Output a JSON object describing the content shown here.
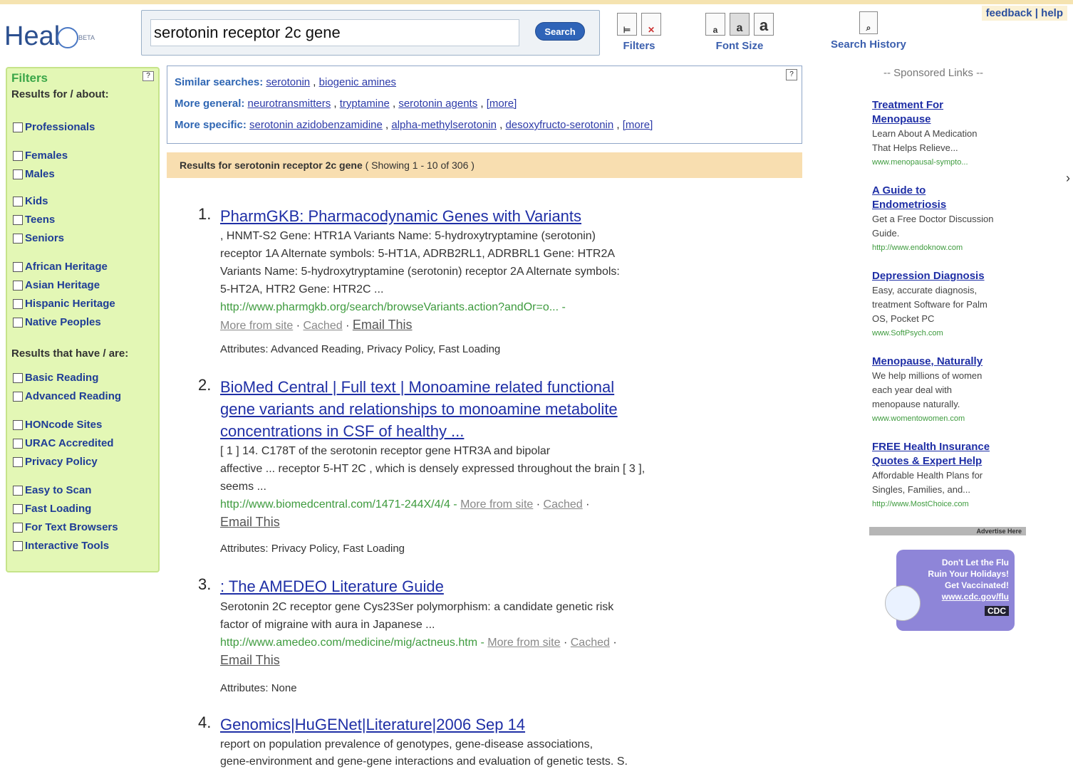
{
  "header": {
    "logo_text": "Heal",
    "logo_beta": "BETA",
    "feedback": "feedback",
    "help": "help",
    "search_value": "serotonin receptor 2c gene",
    "search_button": "Search",
    "filters_label": "Filters",
    "fontsize_label": "Font Size",
    "history_label": "Search History"
  },
  "sidebar": {
    "title": "Filters",
    "help": "?",
    "results_for": "Results for / about:",
    "results_that": "Results that have / are:",
    "items": [
      "Professionals",
      "Females",
      "Males",
      "Kids",
      "Teens",
      "Seniors",
      "African Heritage",
      "Asian Heritage",
      "Hispanic Heritage",
      "Native Peoples",
      "Basic Reading",
      "Advanced Reading",
      "HONcode Sites",
      "URAC Accredited",
      "Privacy Policy",
      "Easy to Scan",
      "Fast Loading",
      "For Text Browsers",
      "Interactive Tools"
    ]
  },
  "similar": {
    "similar_label": "Similar searches:",
    "similar_links": [
      "serotonin",
      "biogenic amines"
    ],
    "general_label": "More general:",
    "general_links": [
      "neurotransmitters",
      "tryptamine",
      "serotonin agents",
      "[more]"
    ],
    "specific_label": "More specific:",
    "specific_links": [
      "serotonin azidobenzamidine",
      "alpha-methylserotonin",
      "desoxyfructo-serotonin",
      "[more]"
    ],
    "help": "?"
  },
  "resbar": {
    "prefix": "Results for",
    "query": "serotonin receptor 2c gene",
    "showing": "( Showing 1 - 10 of 306 )"
  },
  "results": [
    {
      "num": "1.",
      "title": "PharmGKB: Pharmacodynamic Genes with Variants",
      "snippet_lines": [
        ", HNMT-S2 Gene: HTR1A Variants   Name: 5-hydroxytryptamine (serotonin)",
        "receptor 1A Alternate symbols: 5-HT1A, ADRB2RL1, ADRBRL1 Gene: HTR2A",
        "Variants   Name: 5-hydroxytryptamine (serotonin) receptor 2A Alternate symbols:",
        "5-HT2A, HTR2 Gene: HTR2C ..."
      ],
      "url": "http://www.pharmgkb.org/search/browseVariants.action?andOr=o... -",
      "more": "More from site",
      "cached": "Cached",
      "email": "Email This",
      "attributes": "Attributes: Advanced Reading, Privacy Policy, Fast Loading"
    },
    {
      "num": "2.",
      "title_lines": [
        "BioMed Central | Full text | Monoamine related functional",
        "gene variants and relationships to monoamine metabolite",
        "concentrations in CSF of healthy ..."
      ],
      "snippet_lines": [
        "[ 1 ] 14. C178T of the serotonin receptor gene HTR3A and bipolar",
        "affective ... receptor 5-HT 2C , which is densely expressed throughout the brain [ 3 ],",
        "seems ..."
      ],
      "url": "http://www.biomedcentral.com/1471-244X/4/4 -",
      "more": "More from site",
      "cached": "Cached",
      "email": "Email This",
      "attributes": "Attributes: Privacy Policy, Fast Loading"
    },
    {
      "num": "3.",
      "title": ": The AMEDEO Literature Guide",
      "snippet_lines": [
        "Serotonin 2C receptor gene Cys23Ser polymorphism: a candidate genetic risk",
        "factor of migraine with aura in Japanese ..."
      ],
      "url": "http://www.amedeo.com/medicine/mig/actneus.htm -",
      "more": "More from site",
      "cached": "Cached",
      "email": "Email This",
      "attributes": "Attributes: None"
    },
    {
      "num": "4.",
      "title": "Genomics|HuGENet|Literature|2006 Sep 14",
      "snippet_lines": [
        "report on population prevalence of genotypes, gene-disease associations,",
        "gene-environment and gene-gene interactions and evaluation of genetic tests. S."
      ]
    }
  ],
  "ads": {
    "heading": "-- Sponsored Links --",
    "items": [
      {
        "title_lines": [
          "Treatment For",
          "Menopause"
        ],
        "body_lines": [
          "Learn About A Medication",
          "That Helps Relieve..."
        ],
        "url": "www.menopausal-sympto..."
      },
      {
        "title_lines": [
          "A Guide to",
          "Endometriosis"
        ],
        "body_lines": [
          "Get a Free Doctor Discussion",
          "Guide."
        ],
        "url": "http://www.endoknow.com"
      },
      {
        "title_lines": [
          "Depression Diagnosis"
        ],
        "body_lines": [
          "Easy, accurate diagnosis,",
          "treatment Software for Palm",
          "OS, Pocket PC"
        ],
        "url": "www.SoftPsych.com"
      },
      {
        "title_lines": [
          "Menopause, Naturally"
        ],
        "body_lines": [
          "We help millions of women",
          "each year deal with",
          "menopause naturally."
        ],
        "url": "www.womentowomen.com"
      },
      {
        "title_lines": [
          "FREE Health Insurance",
          "Quotes & Expert Help"
        ],
        "body_lines": [
          "Affordable Health Plans for",
          "Singles, Families, and..."
        ],
        "url": "http://www.MostChoice.com"
      }
    ],
    "advertise": "Advertise Here",
    "flu_lines": [
      "Don't Let the Flu",
      "Ruin Your Holidays!",
      "Get Vaccinated!",
      "www.cdc.gov/flu"
    ],
    "cdc": "CDC"
  }
}
